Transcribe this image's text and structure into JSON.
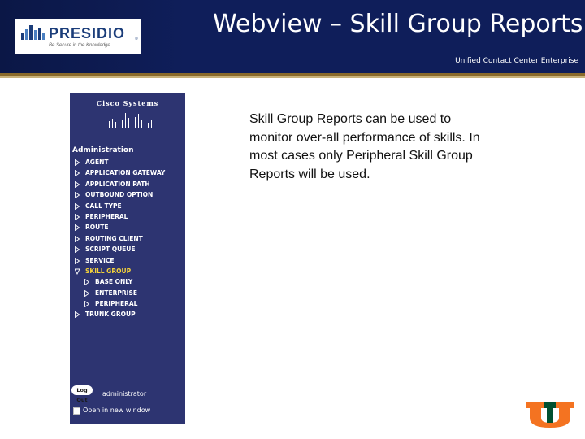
{
  "header": {
    "title": "Webview – Skill Group Reports",
    "subtitle": "Unified Contact Center Enterprise",
    "logo": {
      "name": "PRESIDIO",
      "tm": "®",
      "tagline": "Be Secure in the Knowledge"
    }
  },
  "panel": {
    "brand": "Cisco Systems",
    "section_heading": "Administration",
    "items": [
      {
        "label": "AGENT",
        "level": 1,
        "arrow": "right"
      },
      {
        "label": "APPLICATION GATEWAY",
        "level": 1,
        "arrow": "right"
      },
      {
        "label": "APPLICATION PATH",
        "level": 1,
        "arrow": "right"
      },
      {
        "label": "OUTBOUND OPTION",
        "level": 1,
        "arrow": "right"
      },
      {
        "label": "CALL TYPE",
        "level": 1,
        "arrow": "right"
      },
      {
        "label": "PERIPHERAL",
        "level": 1,
        "arrow": "right"
      },
      {
        "label": "ROUTE",
        "level": 1,
        "arrow": "right"
      },
      {
        "label": "ROUTING CLIENT",
        "level": 1,
        "arrow": "right"
      },
      {
        "label": "SCRIPT QUEUE",
        "level": 1,
        "arrow": "right"
      },
      {
        "label": "SERVICE",
        "level": 1,
        "arrow": "right"
      },
      {
        "label": "SKILL GROUP",
        "level": 1,
        "arrow": "down",
        "active": true
      },
      {
        "label": "BASE ONLY",
        "level": 2,
        "arrow": "right"
      },
      {
        "label": "ENTERPRISE",
        "level": 2,
        "arrow": "right"
      },
      {
        "label": "PERIPHERAL",
        "level": 2,
        "arrow": "right"
      },
      {
        "label": "TRUNK GROUP",
        "level": 1,
        "arrow": "right"
      }
    ],
    "logout_label": "Log Out",
    "user": "administrator",
    "open_new_window_label": "Open in new window",
    "open_new_window_checked": false
  },
  "body_text": "Skill Group Reports can be used to monitor over-all performance of skills. In most cases only Peripheral Skill Group Reports will be used.",
  "colors": {
    "header_bg": "#0f1e5a",
    "panel_bg": "#2d3471",
    "active_item": "#f5d33a",
    "u_orange": "#f47321",
    "u_green": "#005030"
  }
}
